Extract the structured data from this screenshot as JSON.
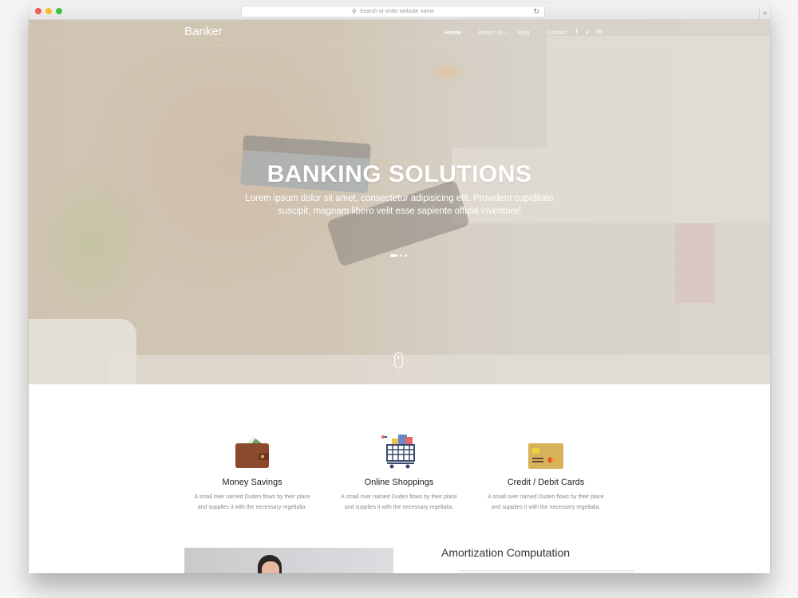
{
  "browser": {
    "url_placeholder": "Search or enter website name",
    "search_icon": "search-icon",
    "reload_icon": "reload-icon",
    "new_tab_icon": "plus-icon"
  },
  "nav": {
    "brand": "Banker",
    "items": [
      {
        "label": "Home",
        "active": true
      },
      {
        "label": "About Us",
        "has_dropdown": true
      },
      {
        "label": "Blog"
      },
      {
        "label": "Contact"
      }
    ],
    "social": [
      {
        "icon": "facebook-icon",
        "glyph": "f"
      },
      {
        "icon": "twitter-icon",
        "glyph": "🐦"
      },
      {
        "icon": "linkedin-icon",
        "glyph": "in"
      }
    ]
  },
  "hero": {
    "title": "BANKING SOLUTIONS",
    "subtitle": "Lorem ipsum dolor sit amet, consectetur adipisicing elit. Provident cupiditate suscipit, magnam libero velit esse sapiente officia inventore!",
    "slides_total": 3,
    "active_slide": 1
  },
  "features": [
    {
      "icon": "wallet-icon",
      "title": "Money Savings",
      "description": "A small river named Duden flows by their place and supplies it with the necessary regelialia."
    },
    {
      "icon": "shopping-cart-icon",
      "title": "Online Shoppings",
      "description": "A small river named Duden flows by their place and supplies it with the necessary regelialia."
    },
    {
      "icon": "credit-card-icon",
      "title": "Credit / Debit Cards",
      "description": "A small river named Duden flows by their place and supplies it with the necessary regelialia."
    }
  ],
  "next_section": {
    "title": "Amortization Computation"
  },
  "colors": {
    "wallet": "#8a4a2b",
    "card": "#d8b25a",
    "cart": "#3b4a6b"
  }
}
